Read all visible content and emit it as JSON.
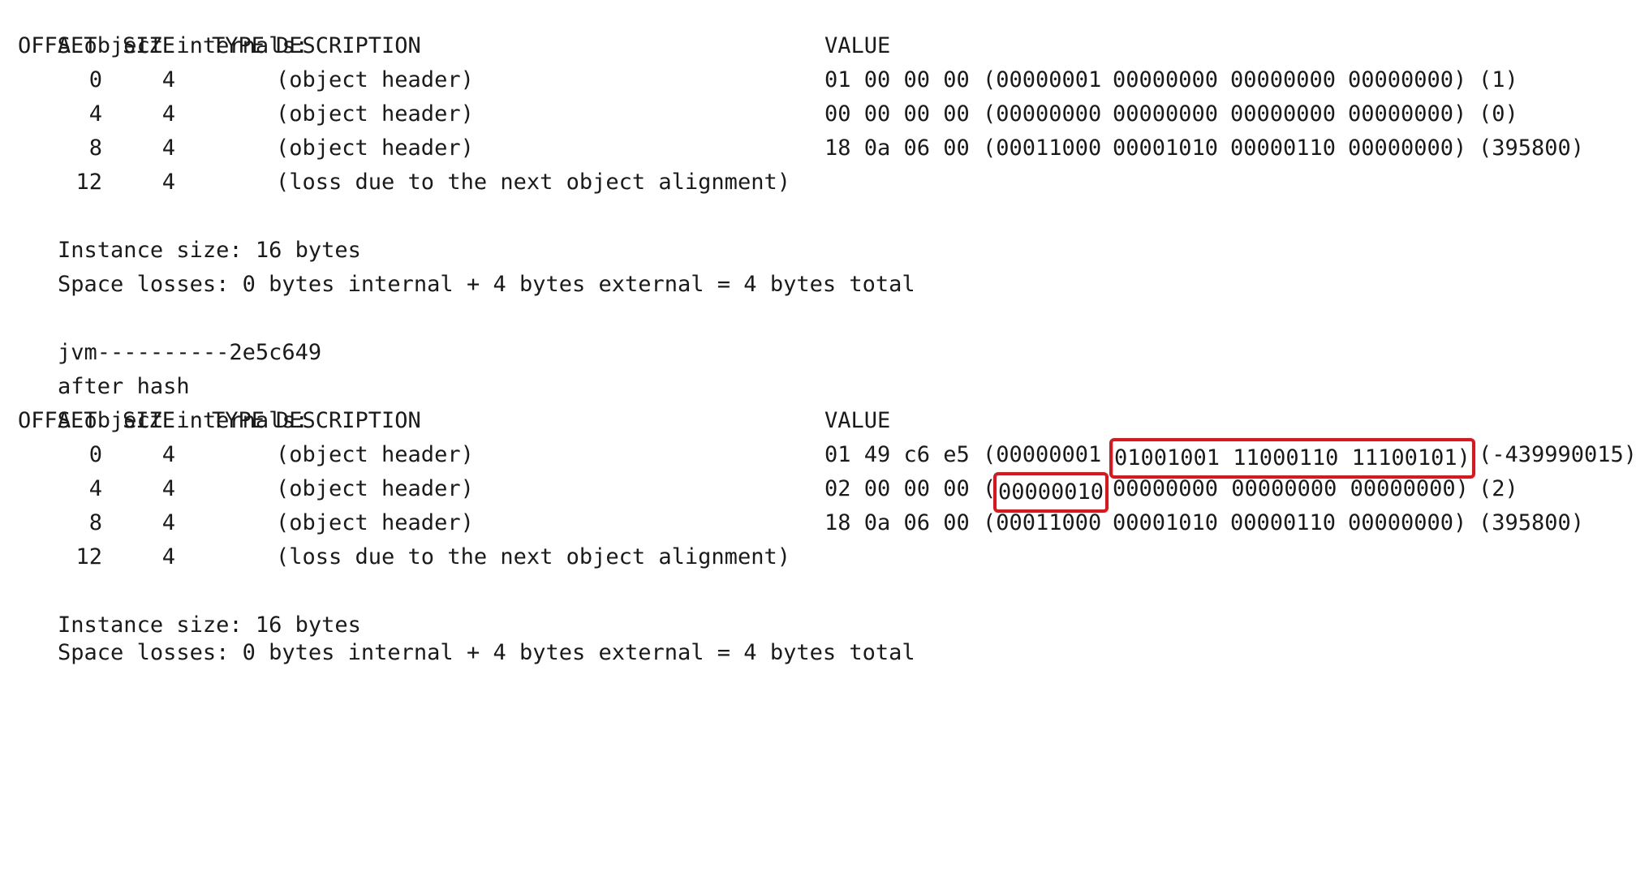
{
  "console": {
    "block1": {
      "header": "A object internals:",
      "columns": {
        "offset": "OFFSET",
        "size": "SIZE",
        "type": "TYPE",
        "description": "DESCRIPTION",
        "value": "VALUE"
      },
      "rows": [
        {
          "offset": "0",
          "size": "4",
          "description": "(object header)",
          "bytes": "01 00 00 00",
          "bin_open": "(00000001",
          "b2": "00000000",
          "b3": "00000000",
          "b4": "00000000)",
          "dec": "(1)"
        },
        {
          "offset": "4",
          "size": "4",
          "description": "(object header)",
          "bytes": "00 00 00 00",
          "bin_open": "(00000000",
          "b2": "00000000",
          "b3": "00000000",
          "b4": "00000000)",
          "dec": "(0)"
        },
        {
          "offset": "8",
          "size": "4",
          "description": "(object header)",
          "bytes": "18 0a 06 00",
          "bin_open": "(00011000",
          "b2": "00001010",
          "b3": "00000110",
          "b4": "00000000)",
          "dec": "(395800)"
        },
        {
          "offset": "12",
          "size": "4",
          "description": "(loss due to the next object alignment)"
        }
      ],
      "instance_size": "Instance size: 16 bytes",
      "space_losses": "Space losses: 0 bytes internal + 4 bytes external = 4 bytes total"
    },
    "jvm_line": "jvm----------2e5c649",
    "after_hash": "after hash",
    "block2": {
      "header": "A object internals:",
      "columns": {
        "offset": "OFFSET",
        "size": "SIZE",
        "type": "TYPE",
        "description": "DESCRIPTION",
        "value": "VALUE"
      },
      "rows": [
        {
          "offset": "0",
          "size": "4",
          "description": "(object header)",
          "bytes": "01 49 c6 e5",
          "bin_open": "(00000001",
          "highlight": "01001001 11000110 11100101)",
          "dec": "(-439990015)"
        },
        {
          "offset": "4",
          "size": "4",
          "description": "(object header)",
          "bytes": "02 00 00 00",
          "paren": "(",
          "highlight": "00000010",
          "rest": "00000000 00000000 00000000)",
          "dec": "(2)"
        },
        {
          "offset": "8",
          "size": "4",
          "description": "(object header)",
          "bytes": "18 0a 06 00",
          "bin_open": "(00011000",
          "b2": "00001010",
          "b3": "00000110",
          "b4": "00000000)",
          "dec": "(395800)"
        },
        {
          "offset": "12",
          "size": "4",
          "description": "(loss due to the next object alignment)"
        }
      ],
      "instance_size": "Instance size: 16 bytes",
      "space_losses": "Space losses: 0 bytes internal + 4 bytes external = 4 bytes total"
    },
    "highlight_color": "#e0141a"
  }
}
